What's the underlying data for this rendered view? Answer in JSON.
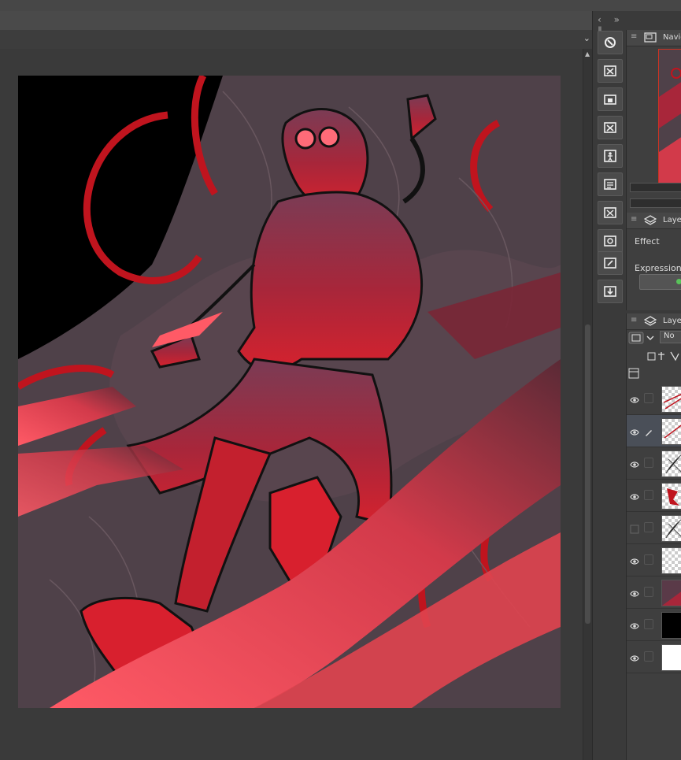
{
  "panels": {
    "navigator": {
      "title": "Navig"
    },
    "layer_property": {
      "title": "Layer",
      "effect_label": "Effect",
      "expression_label": "Expression c"
    },
    "layers": {
      "title": "Layer",
      "blend_mode": "No"
    }
  },
  "layers": [
    {
      "visible": true,
      "editing": false,
      "thumb": "lines"
    },
    {
      "visible": true,
      "editing": true,
      "thumb": "lines2"
    },
    {
      "visible": true,
      "editing": false,
      "thumb": "sketch"
    },
    {
      "visible": true,
      "editing": false,
      "thumb": "red"
    },
    {
      "visible": false,
      "editing": false,
      "thumb": "sketch"
    },
    {
      "visible": true,
      "editing": false,
      "thumb": "empty"
    },
    {
      "visible": true,
      "editing": false,
      "thumb": "gradient"
    },
    {
      "visible": true,
      "editing": false,
      "thumb": "black"
    },
    {
      "visible": true,
      "editing": false,
      "thumb": "white"
    }
  ],
  "tool_icons": [
    "rotate-reset-icon",
    "clear-layer-icon",
    "lock-icon",
    "delete-selection-icon",
    "figure-icon",
    "transform-icon",
    "fit-screen-icon",
    "export-icon",
    "reference-icon",
    "import-icon"
  ],
  "colors": {
    "accent_red": "#c0141e",
    "panel_bg": "#3f3f3f",
    "selected_layer": "#4a4f58"
  }
}
